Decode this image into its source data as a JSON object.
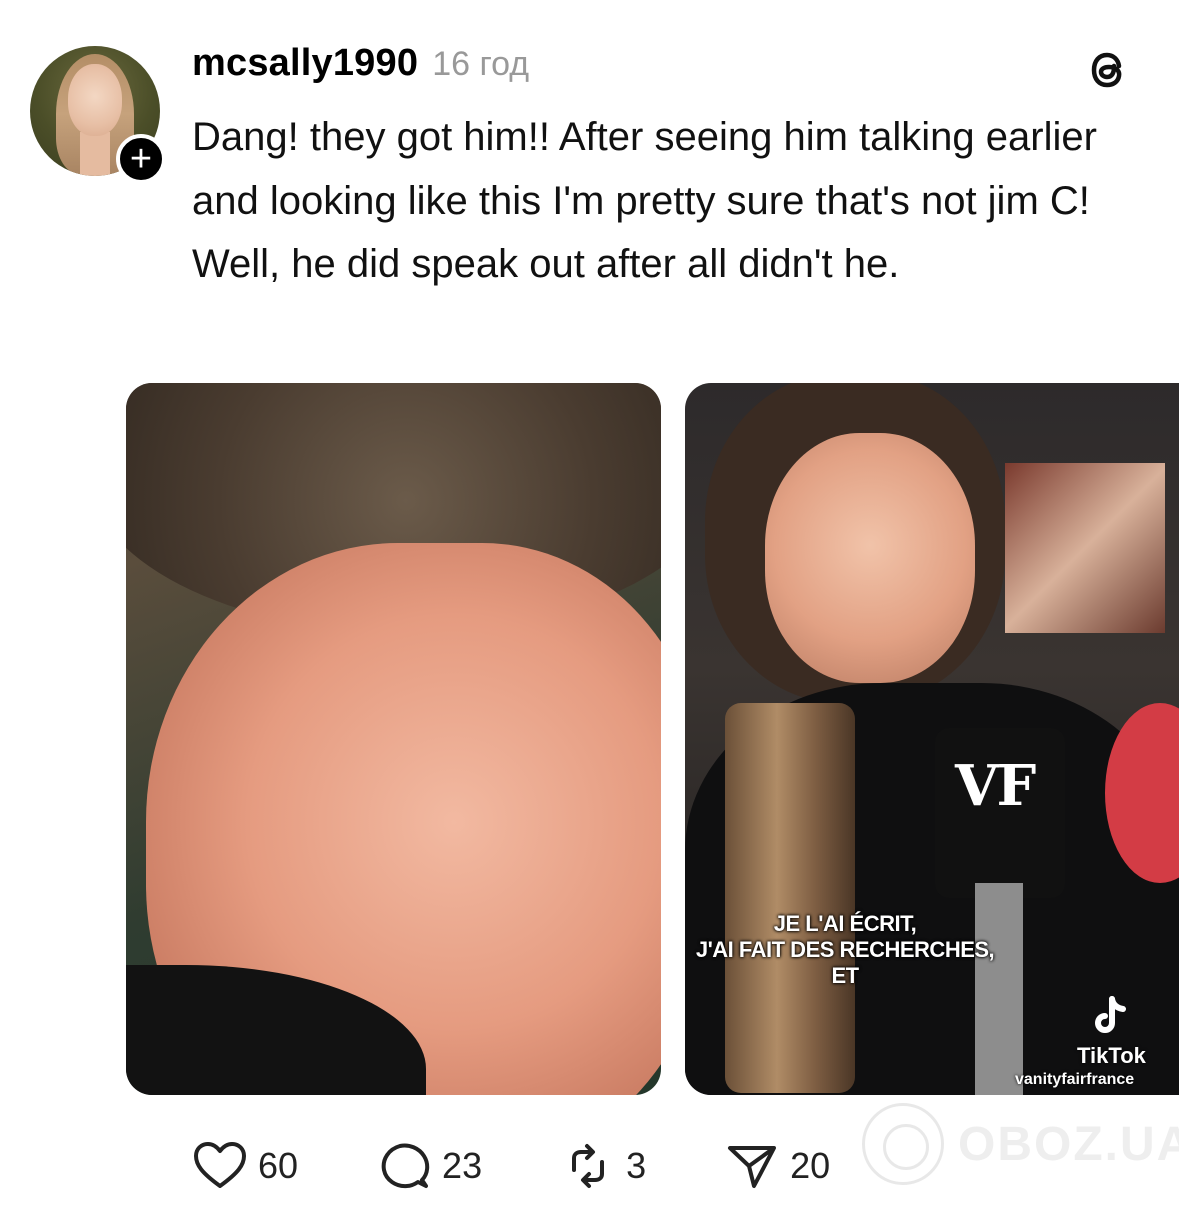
{
  "post": {
    "username": "mcsally1990",
    "timestamp": "16 год",
    "text": "Dang! they got him!! After seeing him talking earlier and looking like this I'm pretty sure that's not jim C! Well, he did speak out after all didn't he.",
    "follow_symbol": "+"
  },
  "images": [
    {
      "name": "closeup-photo"
    },
    {
      "name": "tiktok-screenshot",
      "mic_brand": "VF",
      "caption_line1": "JE L'AI ÉCRIT,",
      "caption_line2": "J'AI FAIT DES RECHERCHES, ET",
      "tiktok_label": "TikTok",
      "tiktok_handle": "vanityfairfrance"
    }
  ],
  "actions": {
    "likes": "60",
    "comments": "23",
    "reposts": "3",
    "shares": "20"
  },
  "watermark": "OBOZ.UA",
  "icons": [
    "threads-logo-icon",
    "heart-icon",
    "comment-icon",
    "repost-icon",
    "share-icon",
    "plus-icon",
    "tiktok-icon"
  ]
}
